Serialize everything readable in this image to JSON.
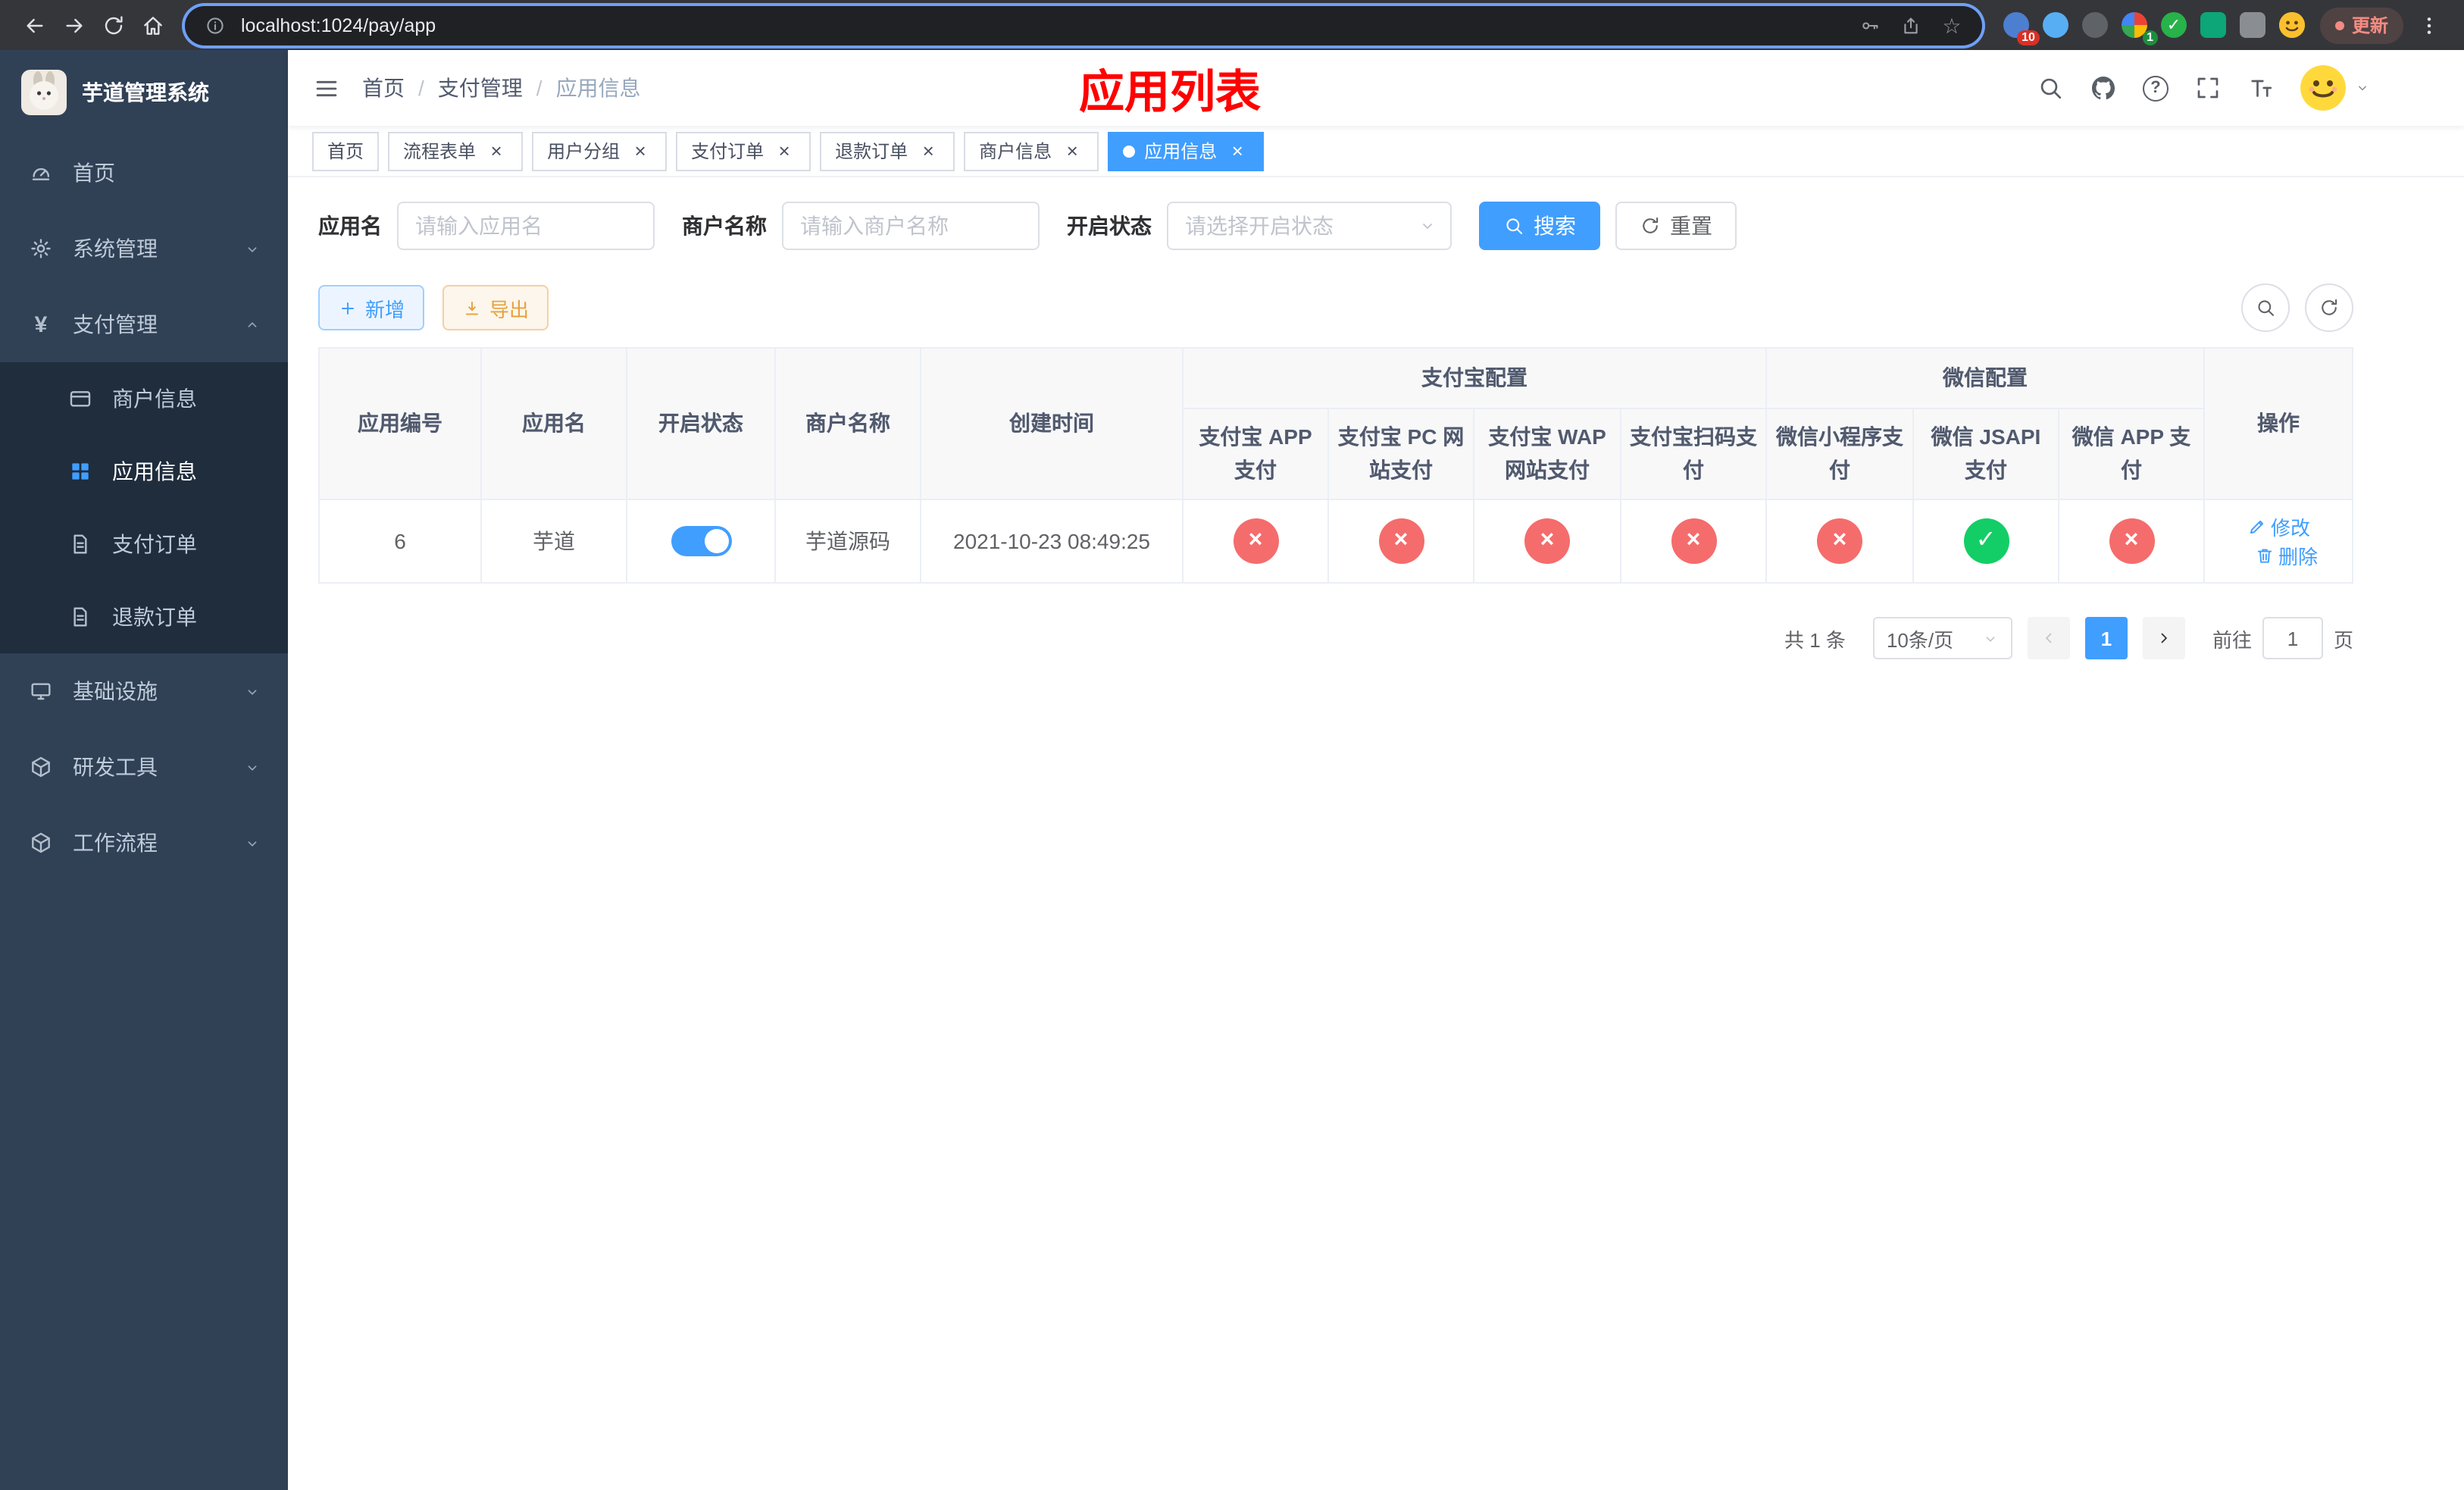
{
  "colors": {
    "primary": "#409eff",
    "danger": "#f56c6c",
    "success": "#13ce66",
    "warning": "#e6a23c",
    "page_title": "#ff0000",
    "sidebar_bg": "#304156",
    "submenu_bg": "#1f2d3d"
  },
  "browser": {
    "url": "localhost:1024/pay/app",
    "update_label": "更新",
    "ext_badge_a": "10",
    "ext_badge_b": "1"
  },
  "sidebar": {
    "title": "芋道管理系统",
    "home": "首页",
    "system": "系统管理",
    "payment": "支付管理",
    "merchant_info": "商户信息",
    "app_info": "应用信息",
    "pay_order": "支付订单",
    "refund_order": "退款订单",
    "infrastructure": "基础设施",
    "dev_tools": "研发工具",
    "workflow": "工作流程"
  },
  "header": {
    "breadcrumb": [
      "首页",
      "支付管理",
      "应用信息"
    ],
    "breadcrumb_sep": "/",
    "page_title": "应用列表"
  },
  "tabs": [
    {
      "label": "首页",
      "active": false,
      "closable": false
    },
    {
      "label": "流程表单",
      "active": false,
      "closable": true
    },
    {
      "label": "用户分组",
      "active": false,
      "closable": true
    },
    {
      "label": "支付订单",
      "active": false,
      "closable": true
    },
    {
      "label": "退款订单",
      "active": false,
      "closable": true
    },
    {
      "label": "商户信息",
      "active": false,
      "closable": true
    },
    {
      "label": "应用信息",
      "active": true,
      "closable": true
    }
  ],
  "filters": {
    "app_name_label": "应用名",
    "app_name_placeholder": "请输入应用名",
    "merchant_label": "商户名称",
    "merchant_placeholder": "请输入商户名称",
    "status_label": "开启状态",
    "status_placeholder": "请选择开启状态",
    "search_label": "搜索",
    "reset_label": "重置"
  },
  "toolbar": {
    "add_label": "新增",
    "export_label": "导出"
  },
  "table": {
    "groups": {
      "alipay": "支付宝配置",
      "wechat": "微信配置"
    },
    "columns": [
      "应用编号",
      "应用名",
      "开启状态",
      "商户名称",
      "创建时间",
      "支付宝 APP 支付",
      "支付宝 PC 网站支付",
      "支付宝 WAP 网站支付",
      "支付宝扫码支付",
      "微信小程序支付",
      "微信 JSAPI 支付",
      "微信 APP 支付",
      "操作"
    ],
    "rows": [
      {
        "id": "6",
        "name": "芋道",
        "enabled": true,
        "merchant": "芋道源码",
        "created": "2021-10-23 08:49:25",
        "configs": [
          false,
          false,
          false,
          false,
          false,
          true,
          false
        ],
        "edit_label": "修改",
        "delete_label": "删除"
      }
    ]
  },
  "pagination": {
    "total": "共 1 条",
    "page_size": "10条/页",
    "page": "1",
    "goto_prefix": "前往",
    "goto_value": "1",
    "goto_suffix": "页"
  },
  "icons": {
    "check": "✓",
    "cross": "×",
    "close": "×",
    "star": "☆",
    "question": "?",
    "yen": "¥",
    "fontsize_big": "T",
    "fontsize_small": "T"
  }
}
